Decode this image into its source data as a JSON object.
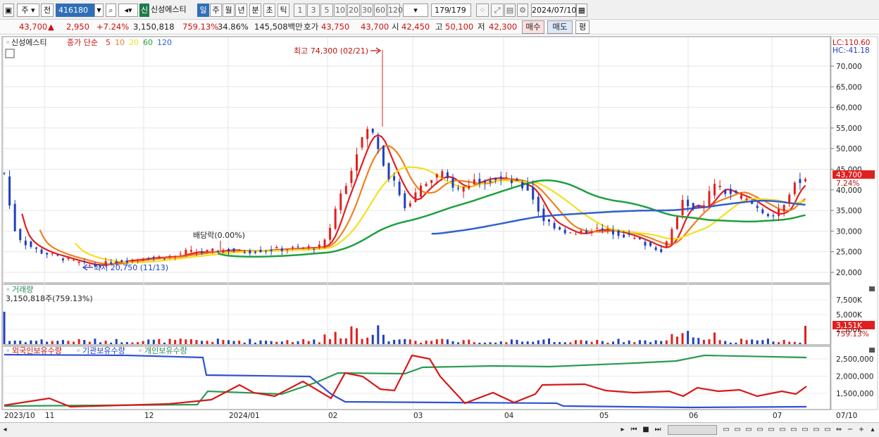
{
  "toolbar": {
    "type_select": "주",
    "prev_label": "전",
    "code": "416180",
    "name_badge": "신",
    "stock_name": "신성에스티",
    "periods": [
      "일",
      "주",
      "월",
      "년",
      "분",
      "초",
      "틱"
    ],
    "selected_period": "일",
    "intervals": [
      "1",
      "3",
      "5",
      "10",
      "20",
      "30",
      "60",
      "120"
    ],
    "count": "179",
    "total": "/179",
    "date": "2024/07/10"
  },
  "quote": {
    "price": "43,700",
    "change": "2,950",
    "change_pct": "+7.24%",
    "volume": "3,150,818",
    "volume_ratio": "759.13%",
    "turnover": "34.86%",
    "amount": "145,508백만",
    "ask_label": "호가",
    "ask1": "43,750",
    "ask2": "43,700",
    "open_label": "시",
    "open": "42,450",
    "high_label": "고",
    "high": "50,100",
    "low_label": "저",
    "low": "42,300",
    "buy_label": "매수",
    "sell_label": "매도",
    "eval_label": "평"
  },
  "legend": {
    "name": "신성에스티",
    "ma_title": "종가 단순",
    "ma_periods": [
      "5",
      "10",
      "20",
      "60",
      "120"
    ],
    "lc": "LC:110.60",
    "hc": "HC:-41.18"
  },
  "annotations": {
    "high": "최고 74,300 (02/21)",
    "low": "최저 20,750 (11/13)",
    "dividend": "배당락(0.00%)",
    "last_price": "43,700",
    "last_pct": "7.24%",
    "vol_last": "3,151K",
    "vol_last_pct": "759.13%"
  },
  "volume_panel": {
    "title": "거래량",
    "info": "3,150,818주(759.13%)",
    "ticks": [
      "7,500K",
      "5,000K",
      "2,500K"
    ]
  },
  "holdings_panel": {
    "titles": [
      "외국인보유수량",
      "기관보유수량",
      "개인보유수량"
    ],
    "ticks": [
      "2,500,000",
      "2,000,000",
      "1,500,000"
    ]
  },
  "price_ticks": [
    "70,000",
    "65,000",
    "60,000",
    "55,000",
    "50,000",
    "45,000",
    "40,000",
    "35,000",
    "30,000",
    "25,000",
    "20,000"
  ],
  "date_labels": [
    "2023/10",
    "11",
    "12",
    "2024/01",
    "02",
    "03",
    "04",
    "05",
    "06",
    "07"
  ],
  "date_right": "07/10",
  "colors": {
    "up": "#e02020",
    "down": "#1f3fbf",
    "ma5": "#e02020",
    "ma10": "#f08020",
    "ma20": "#f2e020",
    "ma60": "#20a040",
    "ma120": "#3060d0"
  },
  "chart_data": {
    "type": "candlestick",
    "price_axis": [
      20000,
      70000
    ],
    "price_high": 74300,
    "price_low": 20750,
    "last_close": 43700,
    "ma_periods": [
      5,
      10,
      20,
      60,
      120
    ]
  }
}
